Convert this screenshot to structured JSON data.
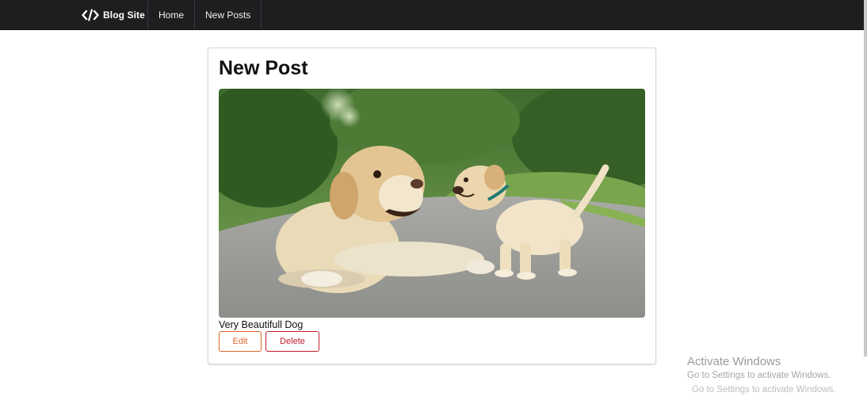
{
  "navbar": {
    "brand": {
      "icon": "code-icon",
      "label": "Blog Site"
    },
    "links": [
      {
        "label": "Home"
      },
      {
        "label": "New Posts"
      }
    ]
  },
  "post": {
    "title": "New Post",
    "image": {
      "subject": "dog-and-puppy-photo"
    },
    "caption": "Very Beautifull Dog",
    "actions": {
      "edit_label": "Edit",
      "delete_label": "Delete"
    }
  },
  "colors": {
    "navbar_bg": "#1d1e20",
    "edit": "#dd6428",
    "delete": "#c21c2c"
  },
  "watermark": {
    "title": "Activate Windows",
    "subtitle": "Go to Settings to activate Windows.",
    "ghost": "Go to Settings to activate Windows."
  }
}
